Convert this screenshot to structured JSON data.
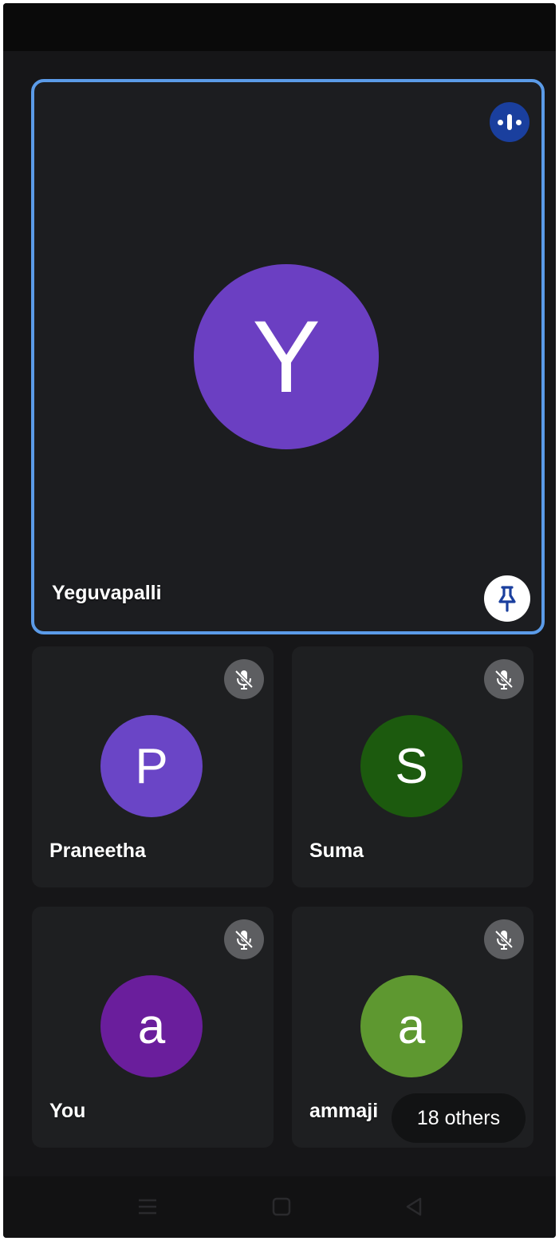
{
  "main_participant": {
    "initial": "Y",
    "name": "Yeguvapalli",
    "avatar_color": "#6b3fc2",
    "speaking_icon": "speaking-indicator-icon",
    "pin_icon": "pin-icon"
  },
  "participants": [
    {
      "initial": "P",
      "name": "Praneetha",
      "avatar_color": "#6a45c6",
      "status_icon": "mic-off-icon"
    },
    {
      "initial": "S",
      "name": "Suma",
      "avatar_color": "#1c5a0e",
      "status_icon": "mic-off-icon"
    },
    {
      "initial": "a",
      "name": "You",
      "avatar_color": "#6a1e9c",
      "status_icon": "mic-off-icon"
    },
    {
      "initial": "a",
      "name": "ammaji",
      "avatar_color": "#5e9830",
      "status_icon": "mic-off-icon"
    }
  ],
  "others_chip": {
    "label": "18 others"
  },
  "accent_color": "#5b9be8",
  "navbar": {
    "icons": [
      "menu-icon",
      "home-icon",
      "back-icon"
    ]
  }
}
